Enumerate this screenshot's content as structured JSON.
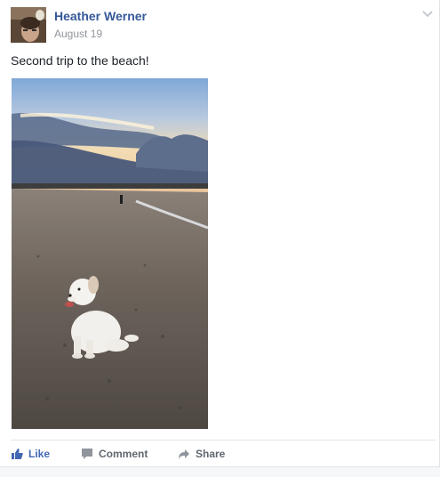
{
  "post": {
    "author": "Heather Werner",
    "date": "August 19",
    "text": "Second trip to the beach!",
    "photo_icon": "beach-photo"
  },
  "actions": {
    "like": "Like",
    "comment": "Comment",
    "share": "Share"
  },
  "colors": {
    "author_link": "#365899",
    "like_accent": "#4267b2",
    "muted": "#90949c"
  }
}
